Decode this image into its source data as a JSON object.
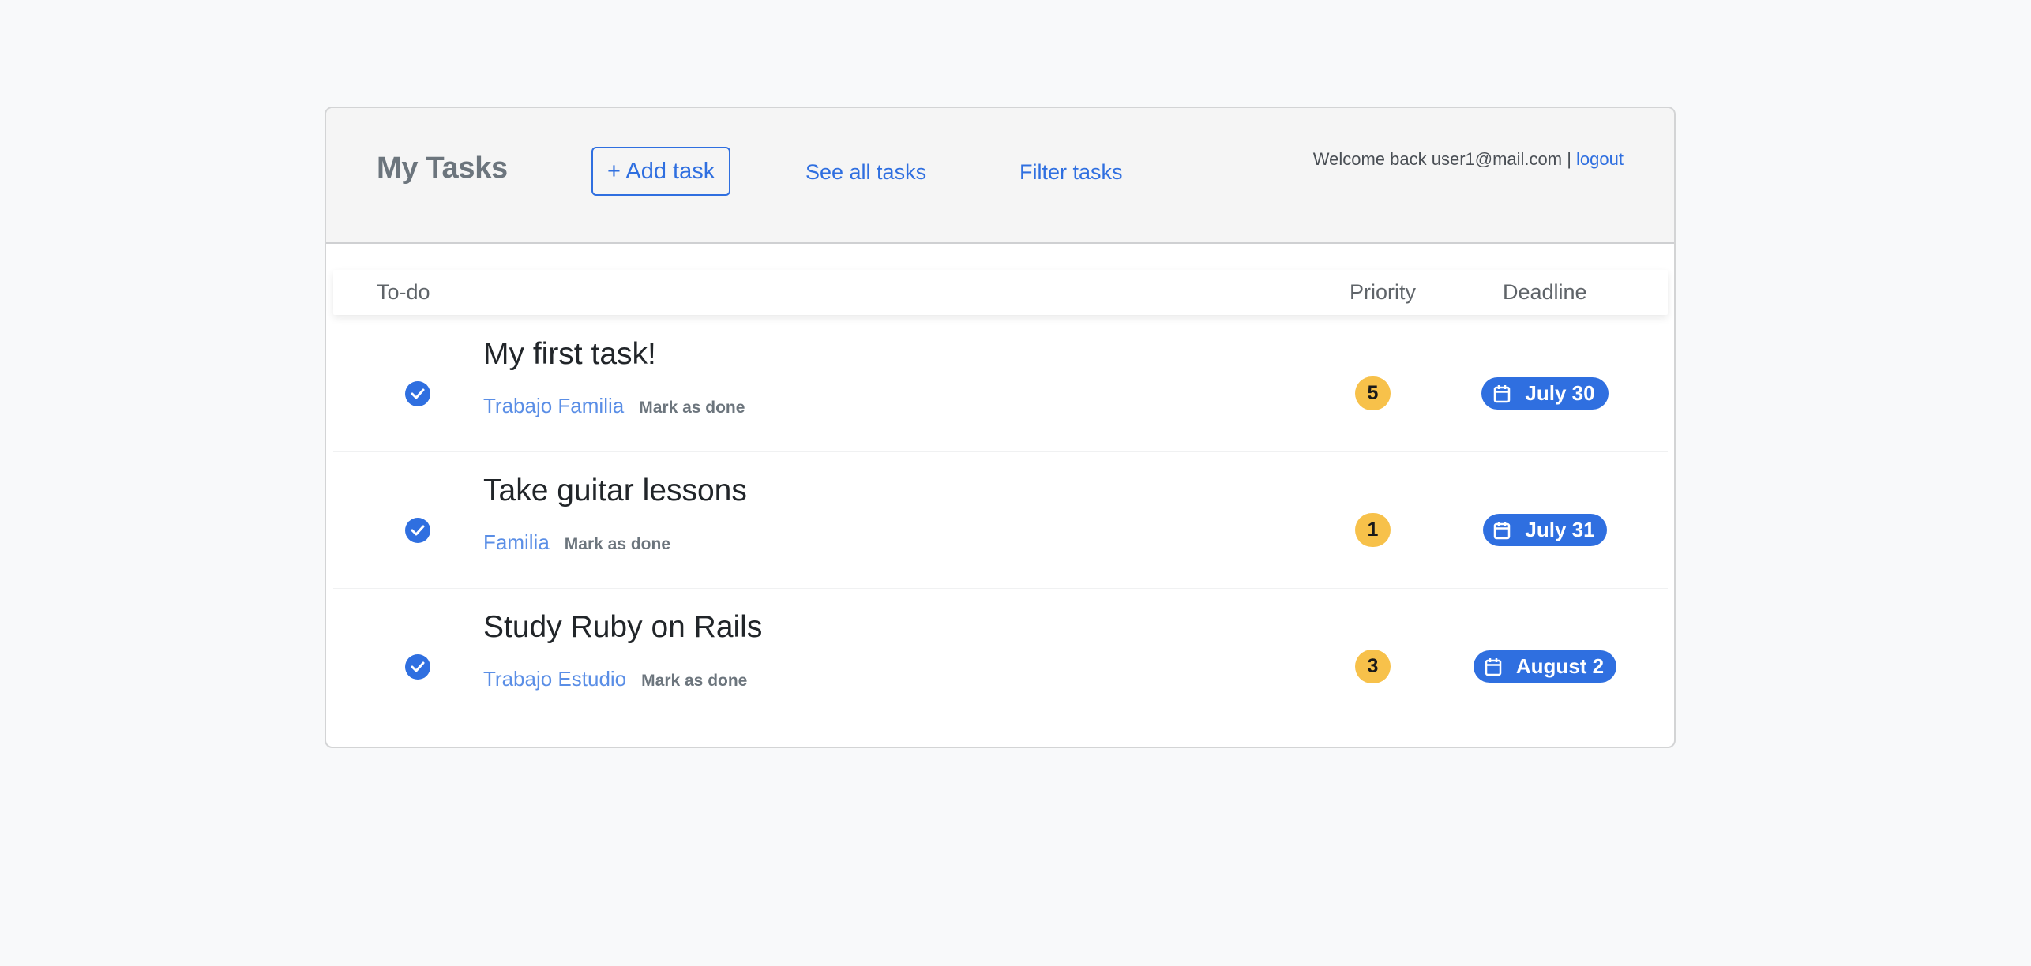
{
  "header": {
    "title": "My Tasks",
    "add_task_label": "+ Add task",
    "see_all_label": "See all tasks",
    "filter_label": "Filter tasks",
    "welcome_text": "Welcome back user1@mail.com |",
    "logout_label": "logout"
  },
  "columns": {
    "todo": "To-do",
    "priority": "Priority",
    "deadline": "Deadline"
  },
  "colors": {
    "accent": "#2f6fe0",
    "priority_badge": "#f7c14a",
    "tag_text": "#5a8ee6"
  },
  "tasks": [
    {
      "title": "My first task!",
      "tags": "Trabajo Familia",
      "mark_done_label": "Mark as done",
      "priority": "5",
      "deadline": "July 30",
      "check_icon": "check-circle-icon",
      "deadline_icon": "calendar-icon"
    },
    {
      "title": "Take guitar lessons",
      "tags": "Familia",
      "mark_done_label": "Mark as done",
      "priority": "1",
      "deadline": "July 31",
      "check_icon": "check-circle-icon",
      "deadline_icon": "calendar-icon"
    },
    {
      "title": "Study Ruby on Rails",
      "tags": "Trabajo Estudio",
      "mark_done_label": "Mark as done",
      "priority": "3",
      "deadline": "August 2",
      "check_icon": "check-circle-icon",
      "deadline_icon": "calendar-icon"
    }
  ]
}
